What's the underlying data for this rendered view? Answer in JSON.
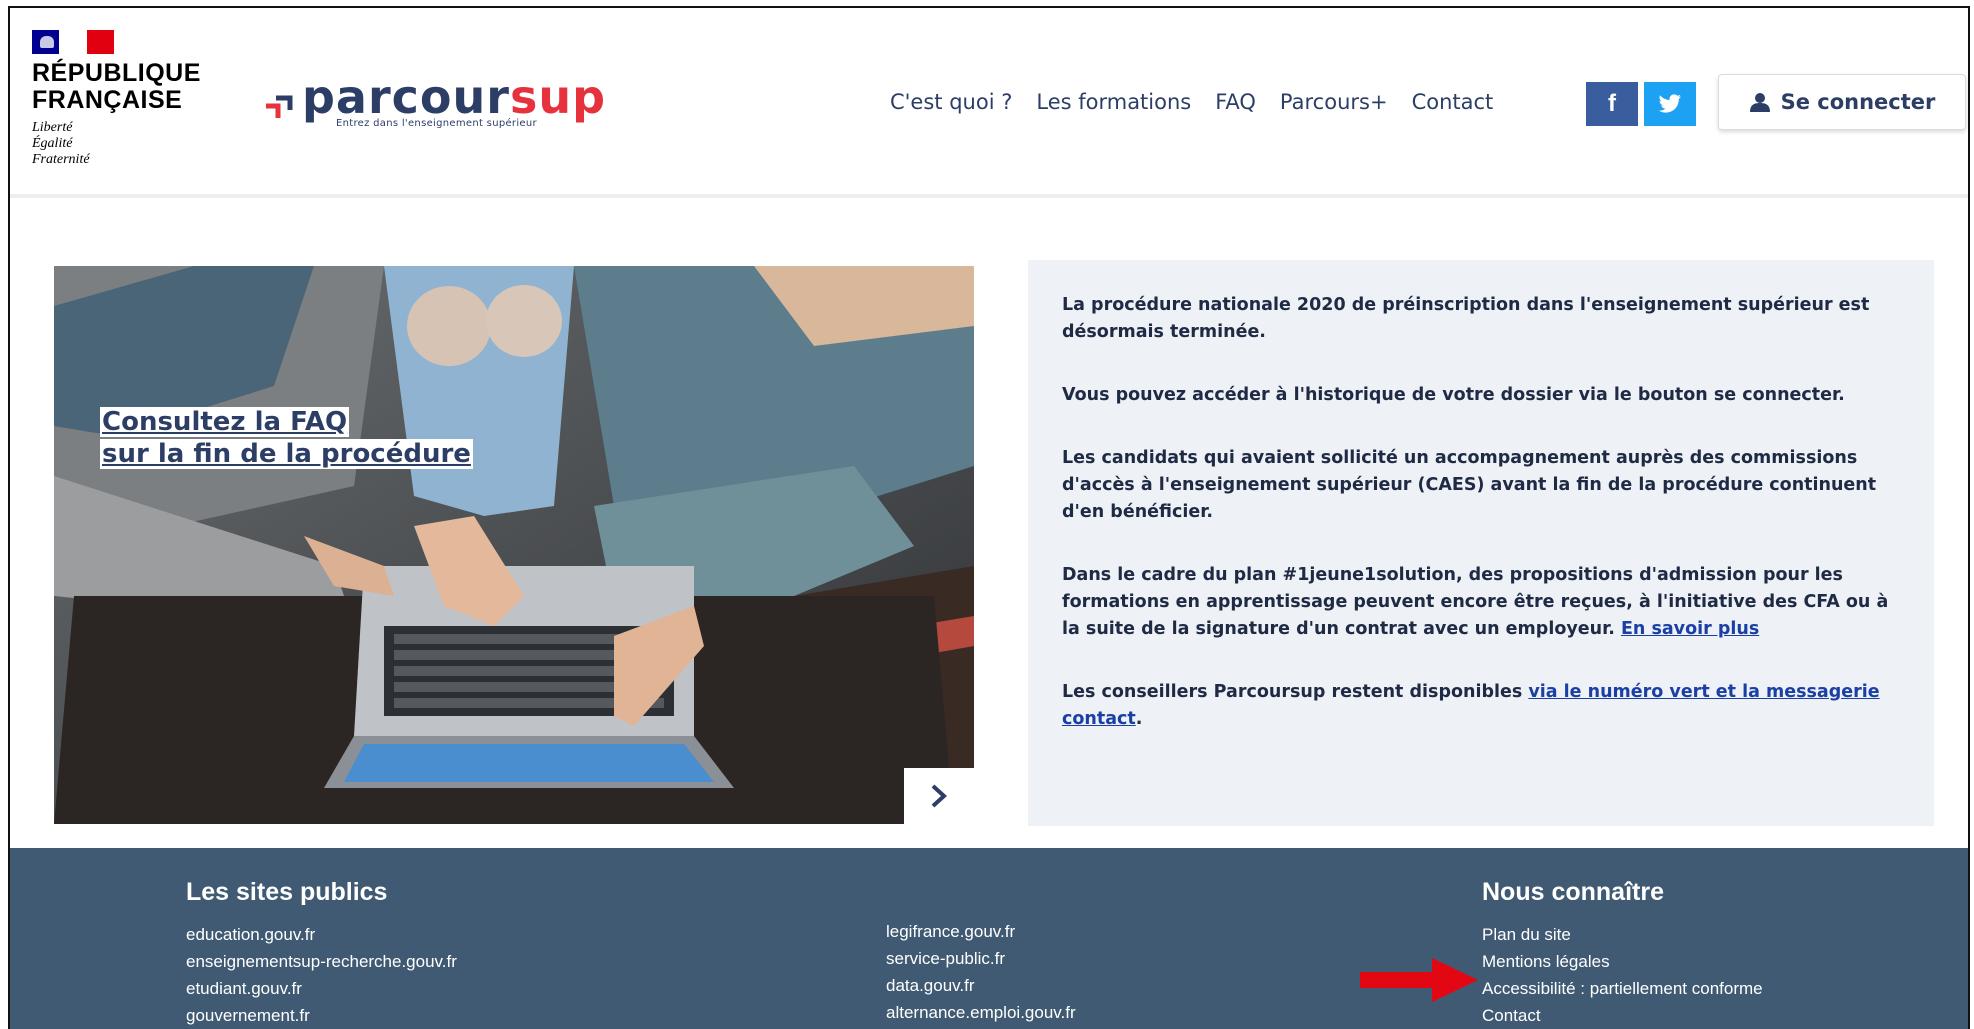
{
  "header": {
    "gov_title_line1": "RÉPUBLIQUE",
    "gov_title_line2": "FRANÇAISE",
    "motto1": "Liberté",
    "motto2": "Égalité",
    "motto3": "Fraternité",
    "logo_part1": "parcour",
    "logo_part2": "sup",
    "logo_tagline": "Entrez dans l'enseignement supérieur",
    "nav": [
      "C'est quoi ?",
      "Les formations",
      "FAQ",
      "Parcours+",
      "Contact"
    ],
    "facebook": "f",
    "login_label": "Se connecter"
  },
  "hero": {
    "caption_line1": "Consultez la FAQ",
    "caption_line2": "sur la fin de la procédure",
    "next_symbol": "›"
  },
  "info": {
    "p1": "La procédure nationale 2020 de préinscription dans l'enseignement supérieur est désormais terminée.",
    "p2": "Vous pouvez accéder à l'historique de votre dossier via le bouton se connecter.",
    "p3": "Les candidats qui avaient sollicité un accompagnement auprès des commissions d'accès à l'enseignement supérieur (CAES) avant la fin de la procédure continuent d'en bénéficier.",
    "p4_text": "Dans le cadre du plan #1jeune1solution, des propositions d'admission pour les formations en apprentissage peuvent encore être reçues, à l'initiative des CFA ou à la suite de la signature d'un contrat avec un employeur.",
    "p4_link": "En savoir plus",
    "p5_text": "Les conseillers Parcoursup restent disponibles",
    "p5_link": "via le numéro vert et la messagerie contact",
    "p5_end": "."
  },
  "footer": {
    "sites_title": "Les sites publics",
    "sites_col1": [
      "education.gouv.fr",
      "enseignementsup-recherche.gouv.fr",
      "etudiant.gouv.fr",
      "gouvernement.fr"
    ],
    "sites_col2": [
      "legifrance.gouv.fr",
      "service-public.fr",
      "data.gouv.fr",
      "alternance.emploi.gouv.fr"
    ],
    "about_title": "Nous connaître",
    "about_links": [
      "Plan du site",
      "Mentions légales",
      "Accessibilité : partiellement conforme",
      "Contact"
    ]
  },
  "colors": {
    "navy": "#2c3e66",
    "red": "#e6323d",
    "footer_bg": "#3f5a72",
    "panel_bg": "#eef1f5",
    "arrow": "#e30613"
  }
}
